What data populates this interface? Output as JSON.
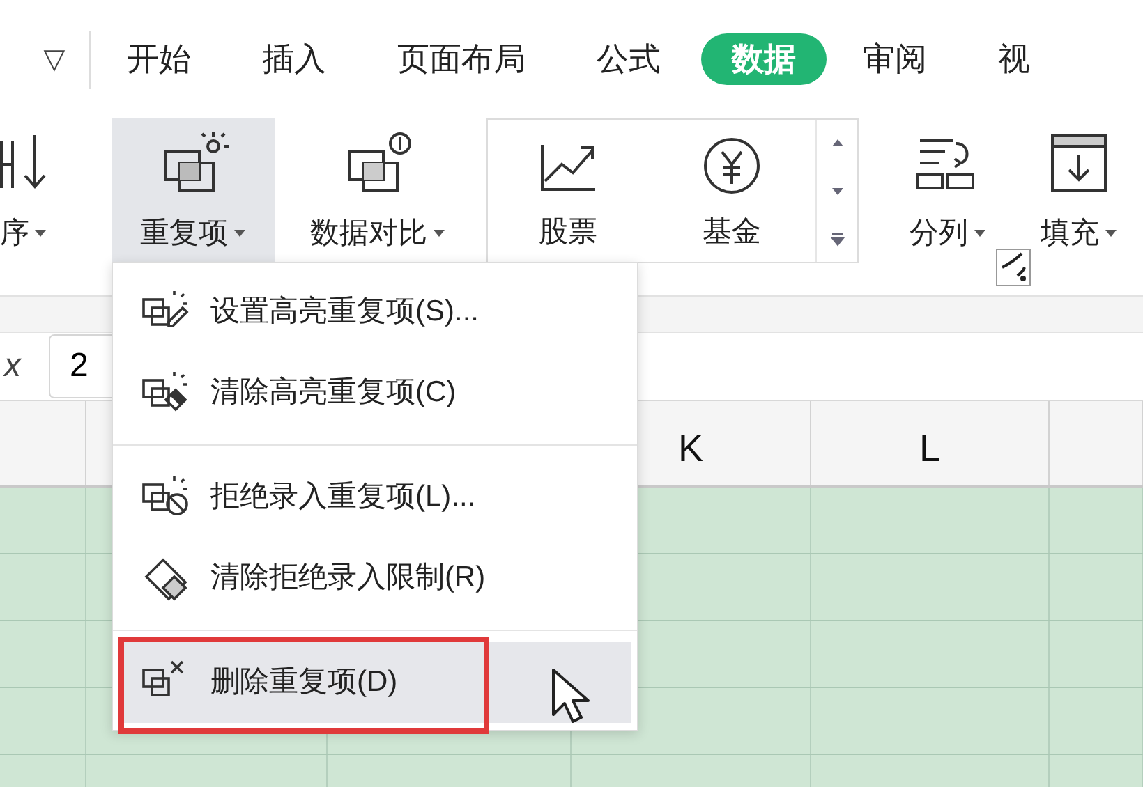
{
  "quick_access": {
    "dropdown": "▽"
  },
  "tabs": [
    {
      "label": "开始",
      "selected": false
    },
    {
      "label": "插入",
      "selected": false
    },
    {
      "label": "页面布局",
      "selected": false
    },
    {
      "label": "公式",
      "selected": false
    },
    {
      "label": "数据",
      "selected": true
    },
    {
      "label": "审阅",
      "selected": false
    },
    {
      "label": "视",
      "selected": false
    }
  ],
  "ribbon": [
    {
      "kind": "sort",
      "label": "序",
      "pressed": false
    },
    {
      "kind": "duplicates",
      "label": "重复项",
      "pressed": true
    },
    {
      "kind": "compare",
      "label": "数据对比",
      "pressed": false
    },
    {
      "kind": "gallery",
      "items": [
        {
          "kind": "stock",
          "label": "股票"
        },
        {
          "kind": "fund",
          "label": "基金"
        }
      ]
    },
    {
      "kind": "split",
      "label": "分列",
      "pressed": false
    },
    {
      "kind": "fill",
      "label": "填充",
      "pressed": false
    }
  ],
  "formula_bar": {
    "fx_label": "x",
    "value": "2"
  },
  "column_headers": [
    {
      "label": "K"
    },
    {
      "label": "L"
    }
  ],
  "menu": [
    {
      "kind": "highlight",
      "label": "设置高亮重复项(S)...",
      "hovered": false,
      "outlined": false
    },
    {
      "kind": "clear-highlight",
      "label": "清除高亮重复项(C)",
      "hovered": false,
      "outlined": false
    },
    {
      "kind": "divider"
    },
    {
      "kind": "reject",
      "label": "拒绝录入重复项(L)...",
      "hovered": false,
      "outlined": false
    },
    {
      "kind": "clear-reject",
      "label": "清除拒绝录入限制(R)",
      "hovered": false,
      "outlined": false
    },
    {
      "kind": "divider"
    },
    {
      "kind": "delete",
      "label": "删除重复项(D)",
      "hovered": true,
      "outlined": true
    }
  ]
}
